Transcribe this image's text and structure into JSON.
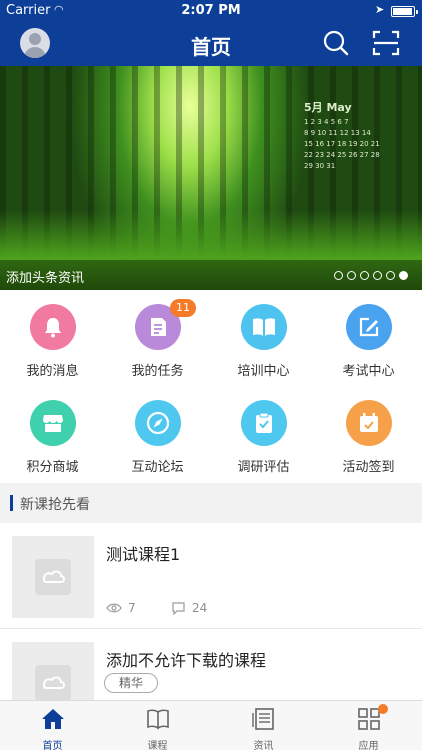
{
  "status": {
    "carrier": "Carrier",
    "time": "2:07 PM"
  },
  "header": {
    "title": "首页",
    "icons": [
      "avatar",
      "search-icon",
      "scan-icon"
    ]
  },
  "banner": {
    "caption": "添加头条资讯",
    "pages": 6,
    "active_page": 6,
    "calendar_title": "5月 May",
    "calendar_rows": [
      "1 2 3 4 5 6 7",
      "8 9 10 11 12 13 14",
      "15 16 17 18 19 20 21",
      "22 23 24 25 26 27 28",
      "29 30 31"
    ]
  },
  "grid": [
    {
      "label": "我的消息",
      "icon": "bell-icon",
      "color": "#f07aa0"
    },
    {
      "label": "我的任务",
      "icon": "document-icon",
      "color": "#b98ad9",
      "badge": "11"
    },
    {
      "label": "培训中心",
      "icon": "book-icon",
      "color": "#4fc3ef"
    },
    {
      "label": "考试中心",
      "icon": "edit-icon",
      "color": "#4aa3ef"
    },
    {
      "label": "积分商城",
      "icon": "store-icon",
      "color": "#3fd0ad"
    },
    {
      "label": "互动论坛",
      "icon": "compass-icon",
      "color": "#4fc8f0"
    },
    {
      "label": "调研评估",
      "icon": "clipboard-icon",
      "color": "#4fc8f0"
    },
    {
      "label": "活动签到",
      "icon": "calendar-check-icon",
      "color": "#f6a04a"
    }
  ],
  "section": {
    "title": "新课抢先看"
  },
  "courses": [
    {
      "title": "测试课程1",
      "views": "7",
      "comments": "24"
    },
    {
      "title": "添加不允许下载的课程",
      "tag": "精华"
    }
  ],
  "tabbar": [
    {
      "label": "首页",
      "icon": "home-icon",
      "active": true
    },
    {
      "label": "课程",
      "icon": "book-open-icon"
    },
    {
      "label": "资讯",
      "icon": "news-icon"
    },
    {
      "label": "应用",
      "icon": "apps-icon",
      "dot": true
    }
  ],
  "colors": {
    "primary": "#0d3f98",
    "badge": "#f47b27"
  }
}
